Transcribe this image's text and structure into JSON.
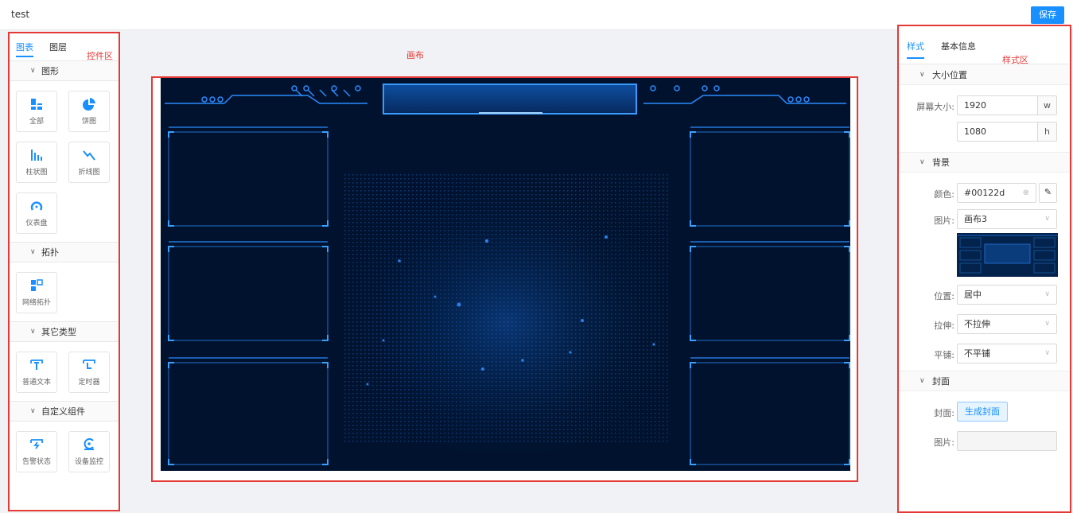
{
  "app": {
    "title": "test",
    "save_label": "保存"
  },
  "left": {
    "tabs": [
      {
        "label": "图表",
        "active": true
      },
      {
        "label": "图层",
        "active": false
      }
    ],
    "region_label": "控件区",
    "sections": [
      {
        "title": "图形",
        "items": [
          {
            "label": "全部",
            "icon": "bar-blocks-icon"
          },
          {
            "label": "饼图",
            "icon": "pie-chart-icon"
          },
          {
            "label": "柱状图",
            "icon": "bar-chart-icon"
          },
          {
            "label": "折线图",
            "icon": "line-chart-icon"
          },
          {
            "label": "仪表盘",
            "icon": "gauge-icon"
          }
        ]
      },
      {
        "title": "拓扑",
        "items": [
          {
            "label": "网络拓扑",
            "icon": "topology-icon"
          }
        ]
      },
      {
        "title": "其它类型",
        "items": [
          {
            "label": "普通文本",
            "icon": "text-icon"
          },
          {
            "label": "定时器",
            "icon": "timer-icon"
          }
        ]
      },
      {
        "title": "自定义组件",
        "items": [
          {
            "label": "告警状态",
            "icon": "alarm-icon"
          },
          {
            "label": "设备监控",
            "icon": "device-monitor-icon"
          }
        ]
      }
    ]
  },
  "canvas": {
    "region_label": "画布",
    "background_color": "#00122d"
  },
  "right": {
    "tabs": [
      {
        "label": "样式",
        "active": true
      },
      {
        "label": "基本信息",
        "active": false
      }
    ],
    "region_label": "样式区",
    "size_section": {
      "title": "大小位置",
      "screen_label": "屏幕大小:",
      "width": "1920",
      "width_unit": "w",
      "height": "1080",
      "height_unit": "h"
    },
    "background_section": {
      "title": "背景",
      "color_label": "颜色:",
      "color_value": "#00122d",
      "image_label": "图片:",
      "image_value": "画布3",
      "position_label": "位置:",
      "position_value": "居中",
      "stretch_label": "拉伸:",
      "stretch_value": "不拉伸",
      "tile_label": "平铺:",
      "tile_value": "不平铺"
    },
    "cover_section": {
      "title": "封面",
      "cover_label": "封面:",
      "generate_label": "生成封面",
      "image_label": "图片:"
    }
  },
  "colors": {
    "accent": "#1890ff",
    "highlight_border": "#e53935",
    "dashboard_bg": "#00122d"
  }
}
